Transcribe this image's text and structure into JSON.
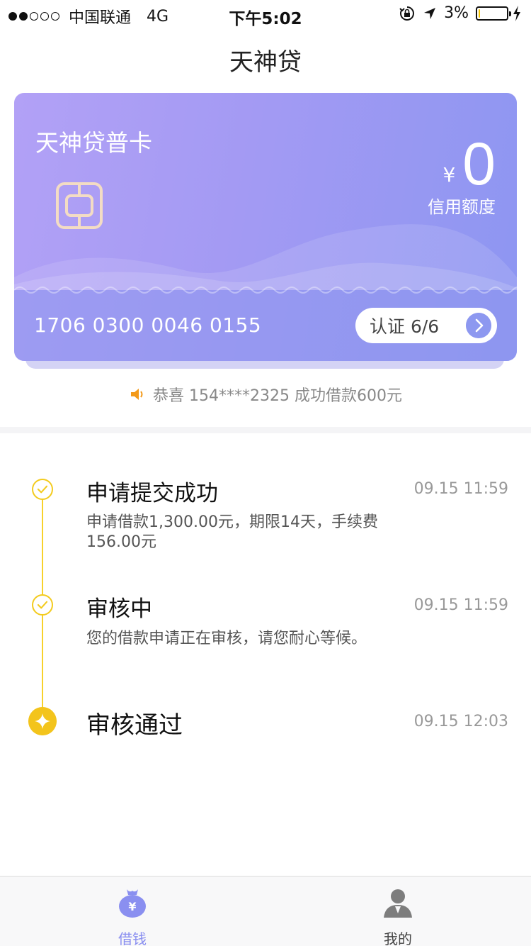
{
  "status_bar": {
    "signal_dots": [
      true,
      true,
      false,
      false,
      false
    ],
    "carrier": "中国联通",
    "network": "4G",
    "time": "下午5:02",
    "battery": "3%",
    "battery_level": 0.03
  },
  "header": {
    "title": "天神贷"
  },
  "card": {
    "name": "天神贷普卡",
    "currency": "¥",
    "amount": "0",
    "amount_label": "信用额度",
    "number": "1706 0300 0046 0155",
    "verify_label": "认证 6/6"
  },
  "notice": {
    "text": "恭喜 154****2325 成功借款600元"
  },
  "timeline": [
    {
      "title": "申请提交成功",
      "time": "09.15 11:59",
      "desc": "申请借款1,300.00元，期限14天，手续费156.00元"
    },
    {
      "title": "审核中",
      "time": "09.15 11:59",
      "desc": "您的借款申请正在审核，请您耐心等候。"
    },
    {
      "title": "审核通过",
      "time": "09.15 12:03",
      "desc": ""
    }
  ],
  "tabs": [
    {
      "label": "借钱",
      "active": true
    },
    {
      "label": "我的",
      "active": false
    }
  ],
  "colors": {
    "accent": "#8a8ff0",
    "timeline": "#f3c41c",
    "card_start": "#b2a1f6",
    "card_end": "#8d96f2"
  }
}
